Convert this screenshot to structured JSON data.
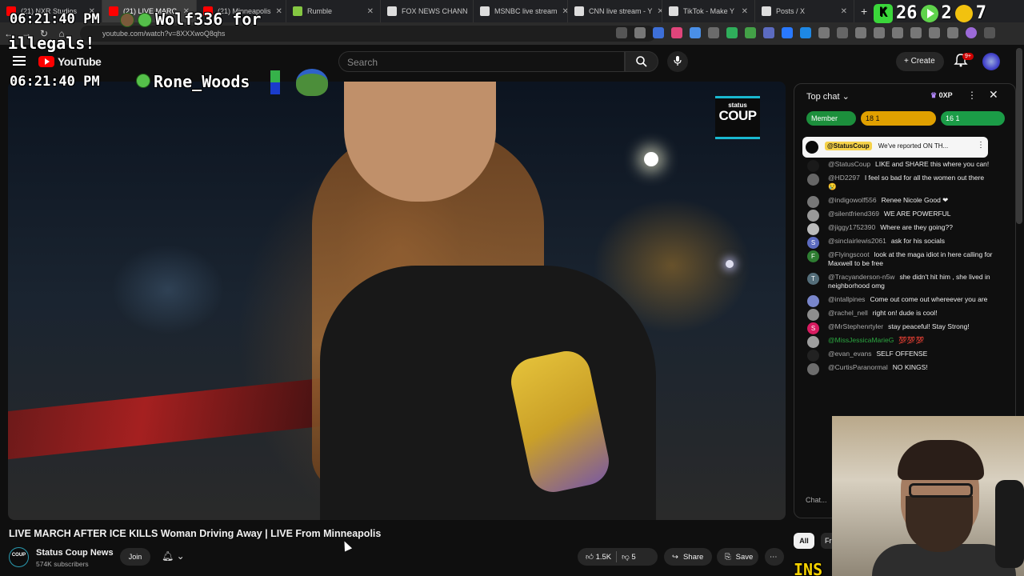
{
  "browser": {
    "tabs": [
      {
        "title": "(21) NXR Studios",
        "color": "#ff0000"
      },
      {
        "title": "(21) LIVE MARC",
        "color": "#ff0000"
      },
      {
        "title": "(21) Minneapolis",
        "color": "#ff0000"
      },
      {
        "title": "Rumble",
        "color": "#85c742"
      },
      {
        "title": "FOX NEWS CHANN",
        "color": "#dddddd"
      },
      {
        "title": "MSNBC live stream",
        "color": "#dddddd"
      },
      {
        "title": "CNN live stream - Y",
        "color": "#dddddd"
      },
      {
        "title": "TikTok - Make Y",
        "color": "#dddddd"
      },
      {
        "title": "Posts / X",
        "color": "#dddddd"
      }
    ],
    "new_tab": "+",
    "url": "youtube.com/watch?v=8XXXwoQ8qhs"
  },
  "overlay": {
    "time1": "06:21:40 PM",
    "name1": "Wolf336 for",
    "line2": "illegals!",
    "time2": "06:21:40 PM",
    "name2": "Rone_Woods",
    "right_k": "K",
    "right_num1": "26",
    "right_num2": "2",
    "right_num3": "7"
  },
  "header": {
    "logo_text": "YouTube",
    "search_placeholder": "Search",
    "create_label": "Create",
    "notif_badge": "9+"
  },
  "video": {
    "watermark_top": "status",
    "watermark_main": "COUP",
    "title": "LIVE MARCH AFTER ICE KILLS Woman Driving Away | LIVE From Minneapolis"
  },
  "channel": {
    "avatar_text": "COUP",
    "name": "Status Coup News",
    "subs": "574K subscribers",
    "join": "Join"
  },
  "actions": {
    "likes": "1.5K",
    "dislikes": "5",
    "share": "Share",
    "save": "Save"
  },
  "chat": {
    "mode": "Top chat",
    "xp": "0XP",
    "ticker": [
      {
        "label": "Member"
      },
      {
        "label": "18  1"
      },
      {
        "label": "16  1"
      }
    ],
    "pinned_author": "@StatusCoup",
    "pinned_text": "We've reported ON TH...",
    "messages": [
      {
        "author": "@StatusCoup",
        "text": "LIKE and SHARE this where you can!",
        "color": "#1a1a1a",
        "initial": "",
        "green": false
      },
      {
        "author": "@HD2297",
        "text": "I feel so bad for all the women out there 😢",
        "color": "#666666",
        "initial": "",
        "green": false
      },
      {
        "author": "@indigowolf556",
        "text": "Renee Nicole Good ❤",
        "color": "#777777",
        "initial": "",
        "green": false
      },
      {
        "author": "@silentfriend369",
        "text": "WE ARE POWERFUL",
        "color": "#999999",
        "initial": "",
        "green": false
      },
      {
        "author": "@jiggy1752390",
        "text": "Where are they going??",
        "color": "#bbbbbb",
        "initial": "",
        "green": false
      },
      {
        "author": "@sinclairlewis2061",
        "text": "ask for his socials",
        "color": "#5c6bc0",
        "initial": "S",
        "green": false
      },
      {
        "author": "@Flyingscoot",
        "text": "look at the maga idiot in here calling for Maxwell to be free",
        "color": "#2e7d32",
        "initial": "F",
        "green": false
      },
      {
        "author": "@Tracyanderson-n5w",
        "text": "she didn't hit him , she lived in neighborhood omg",
        "color": "#546e7a",
        "initial": "T",
        "green": false
      },
      {
        "author": "@intallpines",
        "text": "Come out come out whereever you are",
        "color": "#7986cb",
        "initial": "",
        "green": false
      },
      {
        "author": "@rachel_nell",
        "text": "right on! dude is cool!",
        "color": "#8d8d8d",
        "initial": "",
        "green": false
      },
      {
        "author": "@MrStephenrtyler",
        "text": "stay peaceful! Stay Strong!",
        "color": "#d81b60",
        "initial": "S",
        "green": false
      },
      {
        "author": "@MissJessicaMarieG",
        "text": "💯💯💯",
        "color": "#9e9e9e",
        "initial": "",
        "green": true
      },
      {
        "author": "@evan_evans",
        "text": "SELF OFFENSE",
        "color": "#222222",
        "initial": "",
        "green": false
      },
      {
        "author": "@CurtisParanormal",
        "text": "NO KINGS!",
        "color": "#6d6d6d",
        "initial": "",
        "green": false
      }
    ],
    "input_placeholder": "Chat..."
  },
  "chips": {
    "all": "All",
    "fr": "Fr"
  },
  "webcam": {
    "caption": "INS"
  }
}
